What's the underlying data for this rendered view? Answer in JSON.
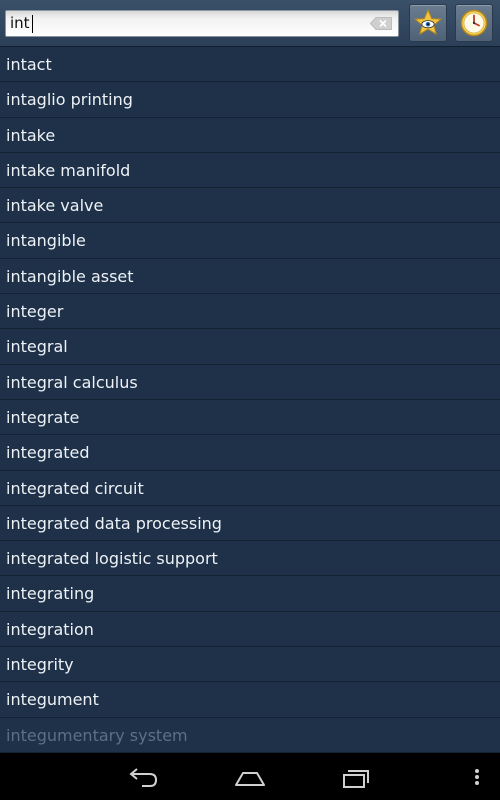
{
  "search": {
    "value": "int",
    "clear_icon": "clear-text-icon"
  },
  "toolbar": {
    "favorites_icon": "star-eye-icon",
    "history_icon": "clock-icon"
  },
  "words": [
    "intact",
    "intaglio printing",
    "intake",
    "intake manifold",
    "intake valve",
    "intangible",
    "intangible asset",
    "integer",
    "integral",
    "integral calculus",
    "integrate",
    "integrated",
    "integrated circuit",
    "integrated data processing",
    "integrated logistic support",
    "integrating",
    "integration",
    "integrity",
    "integument",
    "integumentary system"
  ],
  "navbar": {
    "back_icon": "back-icon",
    "home_icon": "home-icon",
    "recent_icon": "recent-apps-icon",
    "menu_icon": "overflow-menu-icon"
  },
  "colors": {
    "list_background": "#1e3149",
    "list_text": "#eef2f6",
    "separator": "#152435",
    "star": "#f2c440"
  }
}
